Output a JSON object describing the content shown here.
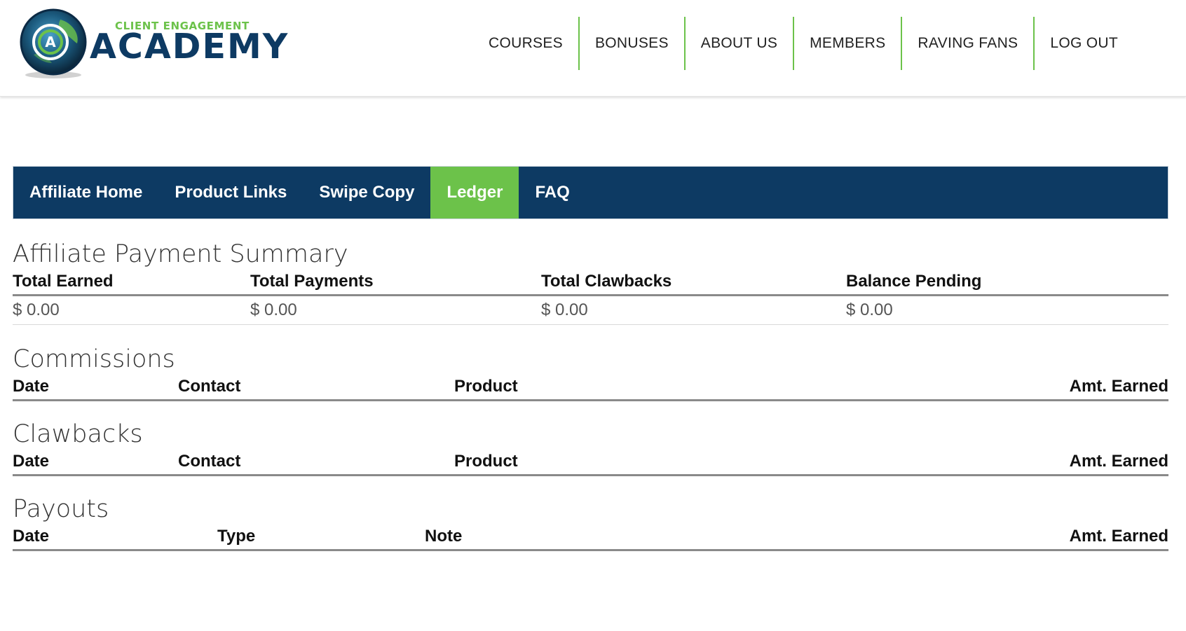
{
  "header": {
    "logo": {
      "small_text": "CLIENT ENGAGEMENT",
      "big_text": "ACADEMY"
    },
    "nav": [
      {
        "label": "COURSES"
      },
      {
        "label": "BONUSES"
      },
      {
        "label": "ABOUT US"
      },
      {
        "label": "MEMBERS"
      },
      {
        "label": "RAVING FANS"
      },
      {
        "label": "LOG OUT"
      }
    ]
  },
  "tabs": [
    {
      "label": "Affiliate Home",
      "active": false
    },
    {
      "label": "Product Links",
      "active": false
    },
    {
      "label": "Swipe Copy",
      "active": false
    },
    {
      "label": "Ledger",
      "active": true
    },
    {
      "label": "FAQ",
      "active": false
    }
  ],
  "summary": {
    "title": "Affiliate Payment Summary",
    "columns": [
      "Total Earned",
      "Total Payments",
      "Total Clawbacks",
      "Balance Pending"
    ],
    "values": [
      "$ 0.00",
      "$ 0.00",
      "$ 0.00",
      "$ 0.00"
    ]
  },
  "commissions": {
    "title": "Commissions",
    "columns": [
      "Date",
      "Contact",
      "Product",
      "Amt. Earned"
    ]
  },
  "clawbacks": {
    "title": "Clawbacks",
    "columns": [
      "Date",
      "Contact",
      "Product",
      "Amt. Earned"
    ]
  },
  "payouts": {
    "title": "Payouts",
    "columns": [
      "Date",
      "Type",
      "Note",
      "Amt. Earned"
    ]
  },
  "colors": {
    "navy": "#0d3a63",
    "green": "#6cc24a"
  }
}
